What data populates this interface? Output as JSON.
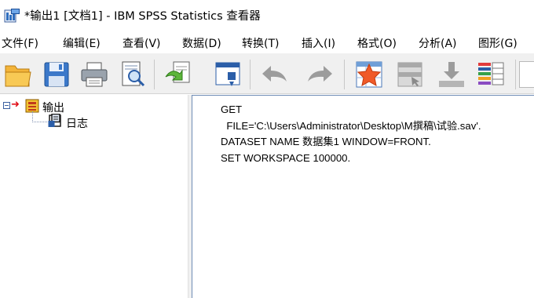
{
  "window": {
    "title": "*输出1 [文档1] - IBM SPSS Statistics 查看器",
    "icon": "spss-viewer-icon"
  },
  "menubar": {
    "items": [
      {
        "label": "文件(F)"
      },
      {
        "label": "编辑(E)"
      },
      {
        "label": "查看(V)"
      },
      {
        "label": "数据(D)"
      },
      {
        "label": "转换(T)"
      },
      {
        "label": "插入(I)"
      },
      {
        "label": "格式(O)"
      },
      {
        "label": "分析(A)"
      },
      {
        "label": "图形(G)"
      }
    ]
  },
  "toolbar": {
    "buttons": [
      {
        "icon": "open-folder-icon",
        "enabled": true
      },
      {
        "icon": "save-icon",
        "enabled": true
      },
      {
        "icon": "print-icon",
        "enabled": true
      },
      {
        "icon": "print-preview-icon",
        "enabled": true
      },
      {
        "icon": "export-icon",
        "enabled": true
      },
      {
        "icon": "recall-dialog-icon",
        "enabled": true
      },
      {
        "icon": "undo-icon",
        "enabled": false
      },
      {
        "icon": "redo-icon",
        "enabled": false
      },
      {
        "icon": "goto-data-icon",
        "enabled": true
      },
      {
        "icon": "goto-case-icon",
        "enabled": false
      },
      {
        "icon": "goto-variable-icon",
        "enabled": false
      },
      {
        "icon": "variables-icon",
        "enabled": true
      }
    ]
  },
  "outline": {
    "root_label": "输出",
    "child_label": "日志"
  },
  "content": {
    "syntax_lines": [
      "GET",
      "  FILE='C:\\Users\\Administrator\\Desktop\\M撰稿\\试验.sav'.",
      "DATASET NAME 数据集1 WINDOW=FRONT.",
      "SET WORKSPACE 100000."
    ]
  },
  "colors": {
    "toolbar_bg": "#f0f0f0",
    "tree_arrow": "#e0101a",
    "pane_border": "#6f8cb5"
  }
}
